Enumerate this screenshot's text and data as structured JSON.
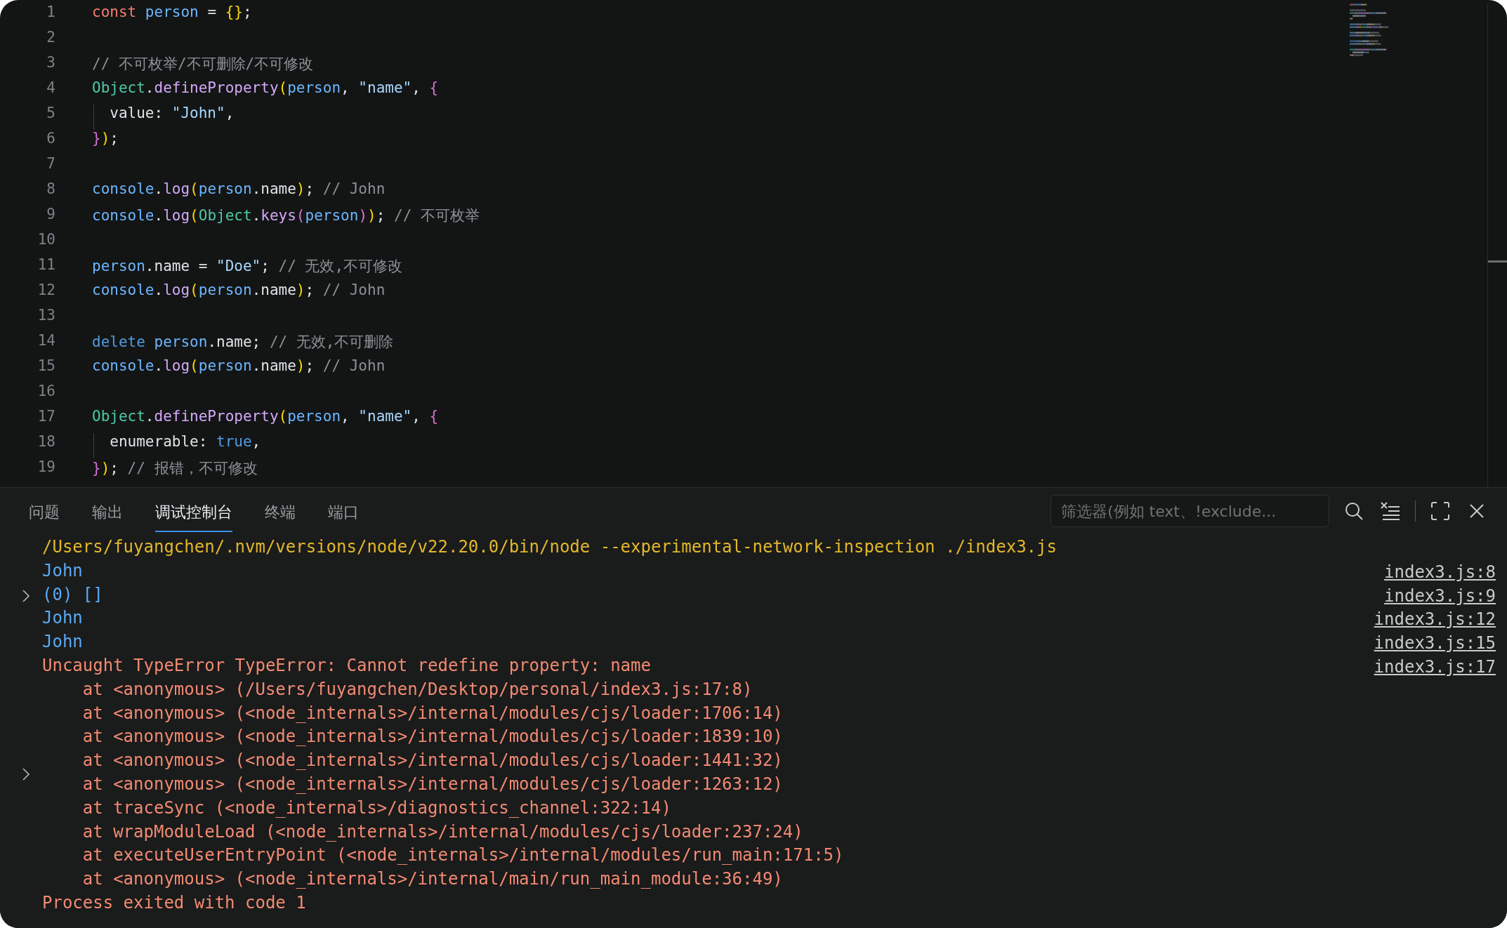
{
  "editor": {
    "lines": [
      {
        "number": "1",
        "tokens": [
          {
            "kind": "keyword",
            "text": "const"
          },
          {
            "kind": "variable",
            "text": " person"
          },
          {
            "kind": "plain",
            "text": " = "
          },
          {
            "kind": "bracket1",
            "text": "{}"
          },
          {
            "kind": "plain",
            "text": ";"
          }
        ]
      },
      {
        "number": "2"
      },
      {
        "number": "3",
        "tokens": [
          {
            "kind": "comment",
            "text": "// 不可枚举/不可删除/不可修改"
          }
        ]
      },
      {
        "number": "4",
        "tokens": [
          {
            "kind": "class",
            "text": "Object"
          },
          {
            "kind": "plain",
            "text": "."
          },
          {
            "kind": "function",
            "text": "defineProperty"
          },
          {
            "kind": "bracket1",
            "text": "("
          },
          {
            "kind": "variable",
            "text": "person"
          },
          {
            "kind": "plain",
            "text": ", "
          },
          {
            "kind": "string",
            "text": "\"name\""
          },
          {
            "kind": "plain",
            "text": ", "
          },
          {
            "kind": "bracket2",
            "text": "{"
          }
        ]
      },
      {
        "number": "5",
        "indented": true,
        "tokens": [
          {
            "kind": "plain",
            "text": "value: "
          },
          {
            "kind": "string",
            "text": "\"John\""
          },
          {
            "kind": "plain",
            "text": ","
          }
        ]
      },
      {
        "number": "6",
        "tokens": [
          {
            "kind": "bracket2",
            "text": "}"
          },
          {
            "kind": "bracket1",
            "text": ")"
          },
          {
            "kind": "plain",
            "text": ";"
          }
        ]
      },
      {
        "number": "7"
      },
      {
        "number": "8",
        "tokens": [
          {
            "kind": "variable",
            "text": "console"
          },
          {
            "kind": "plain",
            "text": "."
          },
          {
            "kind": "function",
            "text": "log"
          },
          {
            "kind": "bracket1",
            "text": "("
          },
          {
            "kind": "variable",
            "text": "person"
          },
          {
            "kind": "plain",
            "text": ".name"
          },
          {
            "kind": "bracket1",
            "text": ")"
          },
          {
            "kind": "plain",
            "text": "; "
          },
          {
            "kind": "comment",
            "text": "// John"
          }
        ]
      },
      {
        "number": "9",
        "tokens": [
          {
            "kind": "variable",
            "text": "console"
          },
          {
            "kind": "plain",
            "text": "."
          },
          {
            "kind": "function",
            "text": "log"
          },
          {
            "kind": "bracket1",
            "text": "("
          },
          {
            "kind": "class",
            "text": "Object"
          },
          {
            "kind": "plain",
            "text": "."
          },
          {
            "kind": "function",
            "text": "keys"
          },
          {
            "kind": "bracket2",
            "text": "("
          },
          {
            "kind": "variable",
            "text": "person"
          },
          {
            "kind": "bracket2",
            "text": ")"
          },
          {
            "kind": "bracket1",
            "text": ")"
          },
          {
            "kind": "plain",
            "text": "; "
          },
          {
            "kind": "comment",
            "text": "// 不可枚举"
          }
        ]
      },
      {
        "number": "10"
      },
      {
        "number": "11",
        "tokens": [
          {
            "kind": "variable",
            "text": "person"
          },
          {
            "kind": "plain",
            "text": ".name = "
          },
          {
            "kind": "string",
            "text": "\"Doe\""
          },
          {
            "kind": "plain",
            "text": "; "
          },
          {
            "kind": "comment",
            "text": "// 无效,不可修改"
          }
        ]
      },
      {
        "number": "12",
        "tokens": [
          {
            "kind": "variable",
            "text": "console"
          },
          {
            "kind": "plain",
            "text": "."
          },
          {
            "kind": "function",
            "text": "log"
          },
          {
            "kind": "bracket1",
            "text": "("
          },
          {
            "kind": "variable",
            "text": "person"
          },
          {
            "kind": "plain",
            "text": ".name"
          },
          {
            "kind": "bracket1",
            "text": ")"
          },
          {
            "kind": "plain",
            "text": "; "
          },
          {
            "kind": "comment",
            "text": "// John"
          }
        ]
      },
      {
        "number": "13"
      },
      {
        "number": "14",
        "tokens": [
          {
            "kind": "operator",
            "text": "delete"
          },
          {
            "kind": "variable",
            "text": " person"
          },
          {
            "kind": "plain",
            "text": ".name; "
          },
          {
            "kind": "comment",
            "text": "// 无效,不可删除"
          }
        ]
      },
      {
        "number": "15",
        "tokens": [
          {
            "kind": "variable",
            "text": "console"
          },
          {
            "kind": "plain",
            "text": "."
          },
          {
            "kind": "function",
            "text": "log"
          },
          {
            "kind": "bracket1",
            "text": "("
          },
          {
            "kind": "variable",
            "text": "person"
          },
          {
            "kind": "plain",
            "text": ".name"
          },
          {
            "kind": "bracket1",
            "text": ")"
          },
          {
            "kind": "plain",
            "text": "; "
          },
          {
            "kind": "comment",
            "text": "// John"
          }
        ]
      },
      {
        "number": "16"
      },
      {
        "number": "17",
        "tokens": [
          {
            "kind": "class",
            "text": "Object"
          },
          {
            "kind": "plain",
            "text": "."
          },
          {
            "kind": "function",
            "text": "defineProperty"
          },
          {
            "kind": "bracket1",
            "text": "("
          },
          {
            "kind": "variable",
            "text": "person"
          },
          {
            "kind": "plain",
            "text": ", "
          },
          {
            "kind": "string",
            "text": "\"name\""
          },
          {
            "kind": "plain",
            "text": ", "
          },
          {
            "kind": "bracket2",
            "text": "{"
          }
        ]
      },
      {
        "number": "18",
        "indented": true,
        "tokens": [
          {
            "kind": "plain",
            "text": "enumerable: "
          },
          {
            "kind": "operator",
            "text": "true"
          },
          {
            "kind": "plain",
            "text": ","
          }
        ]
      },
      {
        "number": "19",
        "tokens": [
          {
            "kind": "bracket2",
            "text": "}"
          },
          {
            "kind": "bracket1",
            "text": ")"
          },
          {
            "kind": "plain",
            "text": "; "
          },
          {
            "kind": "comment",
            "text": "// 报错，不可修改"
          }
        ]
      }
    ]
  },
  "panel": {
    "tabs": [
      {
        "label": "问题",
        "selected": false
      },
      {
        "label": "输出",
        "selected": false
      },
      {
        "label": "调试控制台",
        "selected": true
      },
      {
        "label": "终端",
        "selected": false
      },
      {
        "label": "端口",
        "selected": false
      }
    ],
    "filter": {
      "placeholder": "筛选器(例如 text、!exclude..."
    },
    "console": [
      {
        "kind": "command",
        "text": "/Users/fuyangchen/.nvm/versions/node/v22.20.0/bin/node --experimental-network-inspection ./index3.js"
      },
      {
        "kind": "log",
        "text": "John",
        "source": "index3.js:8"
      },
      {
        "kind": "object",
        "text": "(0) []",
        "source": "index3.js:9",
        "expanded": false
      },
      {
        "kind": "log",
        "text": "John",
        "source": "index3.js:12"
      },
      {
        "kind": "log",
        "text": "John",
        "source": "index3.js:15"
      },
      {
        "kind": "error",
        "text": "Uncaught TypeError TypeError: Cannot redefine property: name",
        "source": "index3.js:17",
        "expanded": false,
        "stack": [
          "at <anonymous> (/Users/fuyangchen/Desktop/personal/index3.js:17:8)",
          "at <anonymous> (<node_internals>/internal/modules/cjs/loader:1706:14)",
          "at <anonymous> (<node_internals>/internal/modules/cjs/loader:1839:10)",
          "at <anonymous> (<node_internals>/internal/modules/cjs/loader:1441:32)",
          "at <anonymous> (<node_internals>/internal/modules/cjs/loader:1263:12)",
          "at traceSync (<node_internals>/diagnostics_channel:322:14)",
          "at wrapModuleLoad (<node_internals>/internal/modules/cjs/loader:237:24)",
          "at executeUserEntryPoint (<node_internals>/internal/modules/run_main:171:5)",
          "at <anonymous> (<node_internals>/internal/main/run_main_module:36:49)"
        ]
      },
      {
        "kind": "exit",
        "text": "Process exited with code 1"
      }
    ]
  }
}
